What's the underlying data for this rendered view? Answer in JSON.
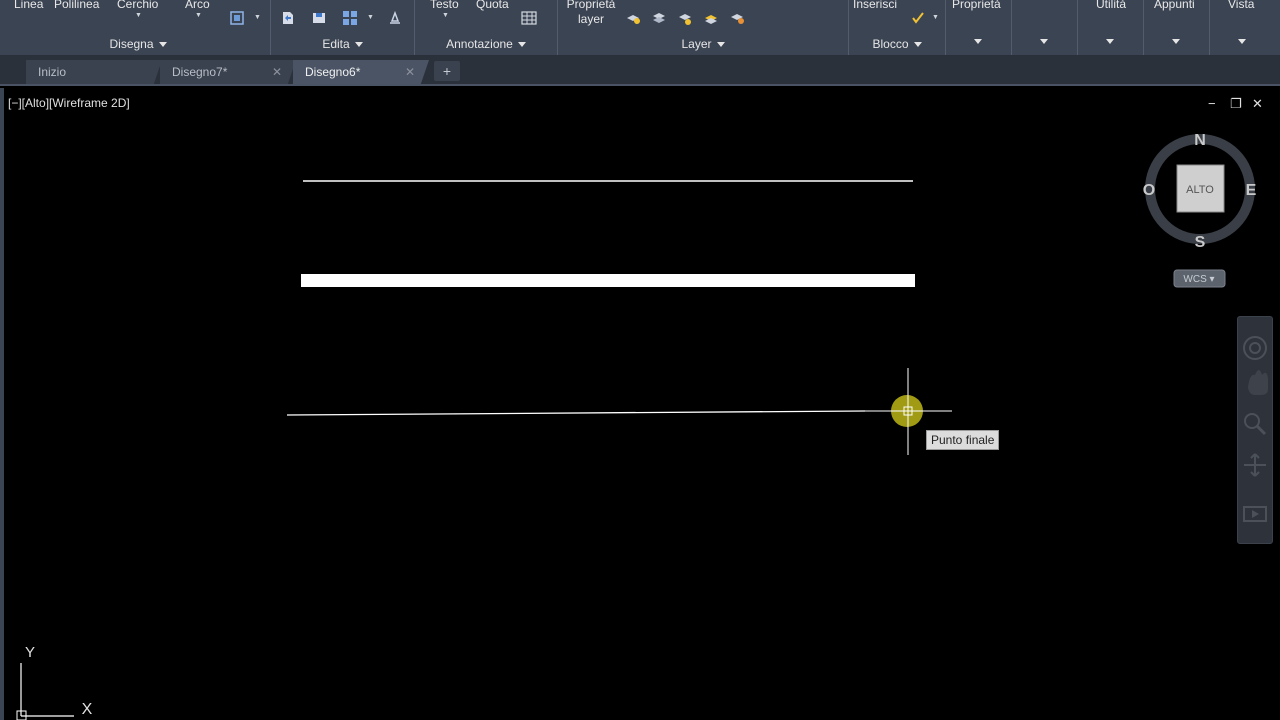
{
  "ribbon": {
    "top_labels": [
      "Linea",
      "Polilinea",
      "Cerchio",
      "Arco",
      "Testo",
      "Quota",
      "Proprietà layer",
      "Inserisci",
      "Proprietà",
      "Utilità",
      "Appunti",
      "Vista"
    ],
    "proprieta_layer_line1": "Proprietà",
    "proprieta_layer_line2": "layer",
    "panels": {
      "disegna": "Disegna",
      "edita": "Edita",
      "annotazione": "Annotazione",
      "layer": "Layer",
      "blocco": "Blocco"
    }
  },
  "tabs": [
    {
      "label": "Inizio",
      "closable": false,
      "active": false
    },
    {
      "label": "Disegno7*",
      "closable": true,
      "active": false
    },
    {
      "label": "Disegno6*",
      "closable": true,
      "active": true
    }
  ],
  "tab_add": "+",
  "viewport": {
    "label": "[−][Alto][Wireframe 2D]",
    "controls": {
      "minimize": "−",
      "restore": "❐",
      "close": "✕"
    }
  },
  "viewcube": {
    "north": "N",
    "south": "S",
    "east": "E",
    "west": "O",
    "face": "ALTO",
    "wcs": "WCS ▾"
  },
  "snap_tooltip": "Punto finale",
  "ucs": {
    "x": "X",
    "y": "Y"
  },
  "colors": {
    "ribbon_bg": "#3b4453",
    "tab_bg": "#2b313b",
    "viewport_bg": "#000000",
    "snap_marker": "#e0d818"
  }
}
